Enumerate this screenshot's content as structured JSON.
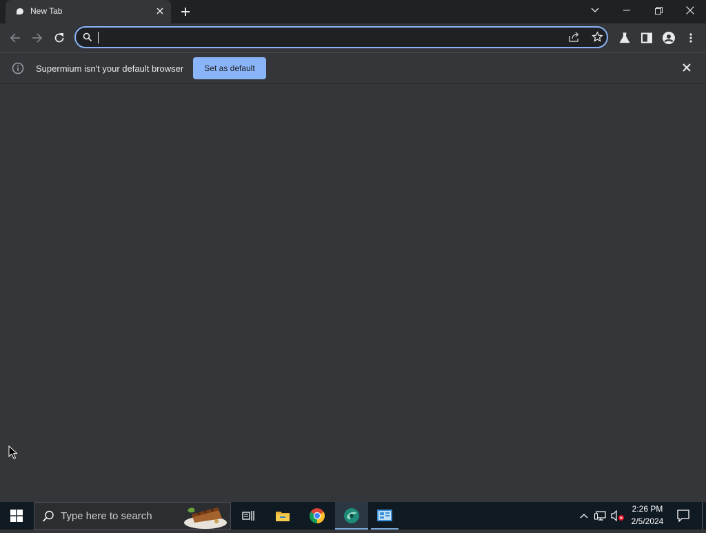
{
  "browser": {
    "tab": {
      "title": "New Tab",
      "favicon": "chat-bubble-icon",
      "close_icon": "close-icon"
    },
    "new_tab_icon": "plus-icon",
    "window_controls": [
      "tab-search-chevron-icon",
      "minimize-icon",
      "restore-icon",
      "close-icon"
    ],
    "toolbar": {
      "back_icon": "back-arrow-icon",
      "forward_icon": "forward-arrow-icon",
      "reload_icon": "reload-icon",
      "omnibox": {
        "value": "",
        "placeholder": "",
        "search_icon": "search-icon",
        "share_icon": "share-icon",
        "bookmark_icon": "star-icon"
      },
      "right_icons": [
        "labs-flask-icon",
        "side-panel-icon",
        "profile-icon",
        "kebab-menu-icon"
      ]
    },
    "infobar": {
      "icon": "info-icon",
      "message": "Supermium isn't your default browser",
      "button_label": "Set as default",
      "close_icon": "close-icon"
    }
  },
  "taskbar": {
    "start_icon": "windows-logo-icon",
    "search": {
      "placeholder": "Type here to search",
      "icon": "search-icon",
      "decoration": "pie-slice-image"
    },
    "pinned": [
      "task-view-icon",
      "file-explorer-icon",
      "chrome-icon",
      "supermium-icon",
      "control-panel-icon"
    ],
    "tray": {
      "icons": [
        "chevron-up-icon",
        "network-icon",
        "volume-muted-icon",
        "notification-icon"
      ],
      "time": "2:26 PM",
      "date": "2/5/2024"
    }
  },
  "colors": {
    "titlebar": "#202124",
    "toolbar": "#35363a",
    "accent": "#8ab4f8",
    "taskbar": "#101a22"
  }
}
